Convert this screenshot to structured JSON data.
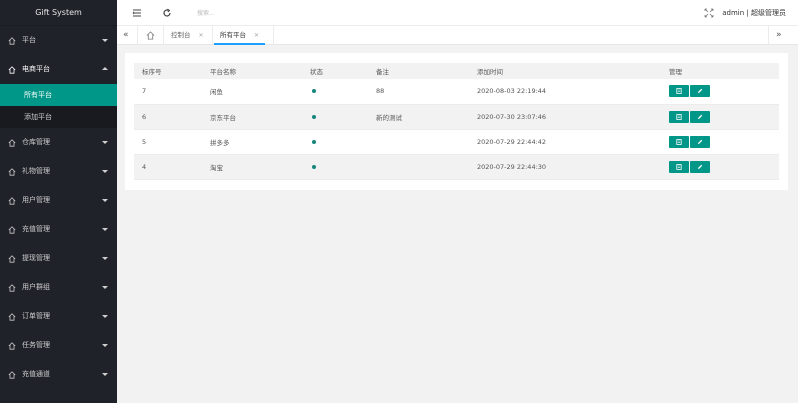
{
  "app": {
    "title": "Gift System"
  },
  "sidebar": {
    "items": [
      {
        "label": "平台",
        "open": false
      },
      {
        "label": "电商平台",
        "open": true,
        "children": [
          {
            "label": "所有平台",
            "active": true
          },
          {
            "label": "添加平台",
            "active": false
          }
        ]
      },
      {
        "label": "仓库管理",
        "open": false
      },
      {
        "label": "礼物管理",
        "open": false
      },
      {
        "label": "用户管理",
        "open": false
      },
      {
        "label": "充值管理",
        "open": false
      },
      {
        "label": "提现管理",
        "open": false
      },
      {
        "label": "用户群组",
        "open": false
      },
      {
        "label": "订单管理",
        "open": false
      },
      {
        "label": "任务管理",
        "open": false
      },
      {
        "label": "充值通道",
        "open": false
      }
    ]
  },
  "header": {
    "search_placeholder": "搜索...",
    "user": "admin | 超级管理员"
  },
  "tabs": [
    {
      "label": "控制台",
      "active": false
    },
    {
      "label": "所有平台",
      "active": true
    }
  ],
  "table": {
    "columns": [
      "标序号",
      "平台名称",
      "状态",
      "备注",
      "添加时间",
      "管理"
    ],
    "rows": [
      {
        "id": "7",
        "name": "闲鱼",
        "status": "active",
        "note": "88",
        "added": "2020-08-03 22:19:44"
      },
      {
        "id": "6",
        "name": "京东平台",
        "status": "active",
        "note": "新的测试",
        "added": "2020-07-30 23:07:46"
      },
      {
        "id": "5",
        "name": "拼多多",
        "status": "active",
        "note": "",
        "added": "2020-07-29 22:44:42"
      },
      {
        "id": "4",
        "name": "淘宝",
        "status": "active",
        "note": "",
        "added": "2020-07-29 22:44:30"
      }
    ]
  },
  "colors": {
    "accent": "#009688",
    "sidebar_bg": "#20222a",
    "status_dot": "#16877a"
  }
}
